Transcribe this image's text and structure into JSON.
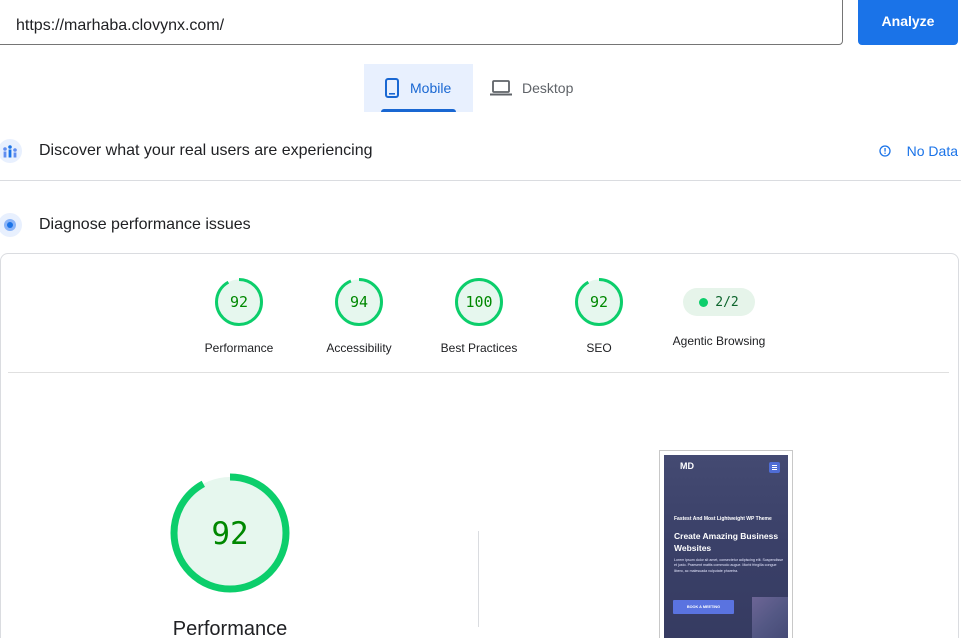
{
  "search": {
    "url_value": "https://marhaba.clovynx.com/"
  },
  "toolbar": {
    "analyze_label": "Analyze"
  },
  "tabs": [
    {
      "label": "Mobile",
      "icon": "smartphone-icon",
      "selected": true
    },
    {
      "label": "Desktop",
      "icon": "laptop-icon",
      "selected": false
    }
  ],
  "crux": {
    "title": "Discover what your real users are experiencing",
    "status": "No Data",
    "icon": "users-chart-icon"
  },
  "lab": {
    "title": "Diagnose performance issues",
    "icon": "lighthouse-icon"
  },
  "categories": [
    {
      "label": "Performance",
      "score": "92",
      "fraction": 0.92
    },
    {
      "label": "Accessibility",
      "score": "94",
      "fraction": 0.94
    },
    {
      "label": "Best Practices",
      "score": "100",
      "fraction": 1.0
    },
    {
      "label": "SEO",
      "score": "92",
      "fraction": 0.92
    }
  ],
  "agentic": {
    "label": "Agentic Browsing",
    "value": "2/2"
  },
  "performance_detail": {
    "score": "92",
    "label": "Performance",
    "fraction": 0.92
  },
  "screenshot": {
    "logo": "MD",
    "eyebrow": "Fastest And Most Lightweight WP Theme",
    "headline": "Create Amazing Business Websites",
    "body": "Lorem ipsum dolor sit amet, consectetur adipiscing elit. Suspendisse et justo. Praesent mattis commodo augue. Morbi fringilla congue libero, ac malesuada vulputate pharetra.",
    "button": "BOOK A MEETING"
  },
  "colors": {
    "accent": "#1a73e8",
    "pass": "#0cce6b",
    "pass_fill": "#e6f7ee",
    "pass_text": "#008800"
  }
}
